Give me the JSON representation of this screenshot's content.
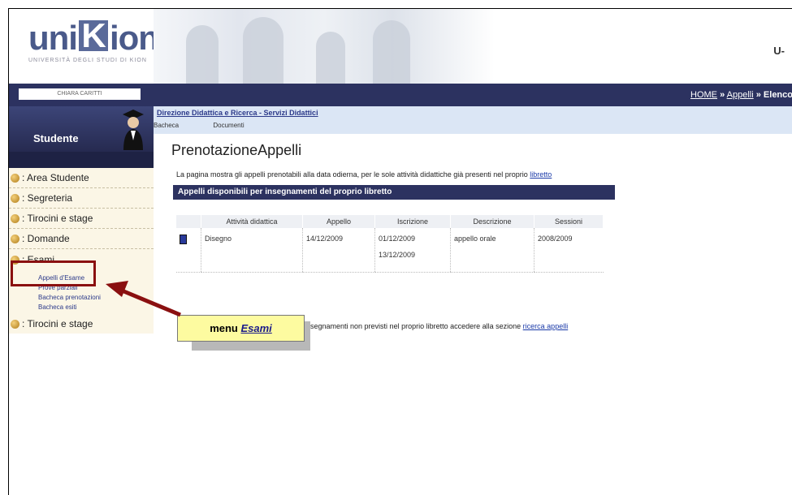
{
  "header": {
    "logo_prefix": "uni",
    "logo_k": "K",
    "logo_suffix": "ion",
    "logo_subtitle": "UNIVERSITÀ DEGLI STUDI DI KION",
    "right_text": "U-"
  },
  "breadcrumb": {
    "home": "HOME",
    "sep1": "»",
    "appelli": "Appelli",
    "sep2": "»",
    "current": "Elenco"
  },
  "user": {
    "name": "CHIARA CARITTI",
    "role": "Studente"
  },
  "sidebar": {
    "items": [
      {
        "label": ": Area Studente"
      },
      {
        "label": ": Segreteria"
      },
      {
        "label": ": Tirocini e stage"
      },
      {
        "label": ": Domande"
      },
      {
        "label": ": Esami"
      }
    ],
    "submenu": [
      "Appelli d'Esame",
      "Prove parziali",
      "Bacheca prenotazioni",
      "Bacheca esiti"
    ],
    "last_item": ": Tirocini e stage"
  },
  "topbar": {
    "direzione": "Direzione Didattica e Ricerca - Servizi Didattici",
    "tab1": "Bacheca",
    "tab2": "Documenti"
  },
  "main": {
    "title": "PrenotazioneAppelli",
    "intro_text": "La pagina mostra gli appelli prenotabili alla data odierna, per le sole attività didattiche già presenti nel proprio",
    "intro_link": "libretto",
    "table_header": "Appelli disponibili per insegnamenti del proprio libretto",
    "columns": [
      "Attività didattica",
      "Appello",
      "Iscrizione",
      "Descrizione",
      "Sessioni"
    ],
    "rows": [
      {
        "attivita": "Disegno",
        "appello": "14/12/2009",
        "iscrizione_from": "01/12/2009",
        "iscrizione_to": "13/12/2009",
        "descrizione": "appello orale",
        "sessioni": "2008/2009"
      }
    ],
    "note_text": "insegnamenti non previsti nel proprio libretto accedere alla sezione",
    "note_link": "ricerca appelli"
  },
  "callout": {
    "prefix": "menu",
    "emph": "Esami"
  },
  "colors": {
    "navy": "#2c3260",
    "annotation_red": "#8a1010",
    "callout_yellow": "#fdfba0"
  }
}
